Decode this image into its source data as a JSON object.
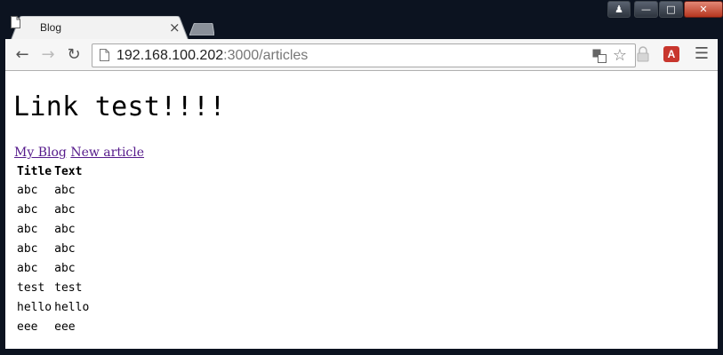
{
  "browser": {
    "tab": {
      "title": "Blog"
    },
    "address": {
      "host": "192.168.100.202",
      "rest": ":3000/articles"
    },
    "extensions": {
      "a_label": "A"
    }
  },
  "page": {
    "heading": "Link test!!!!",
    "links": [
      {
        "label": "My Blog"
      },
      {
        "label": "New article"
      }
    ],
    "table": {
      "headers": [
        "Title",
        "Text"
      ],
      "rows": [
        [
          "abc",
          "abc"
        ],
        [
          "abc",
          "abc"
        ],
        [
          "abc",
          "abc"
        ],
        [
          "abc",
          "abc"
        ],
        [
          "abc",
          "abc"
        ],
        [
          "test",
          "test"
        ],
        [
          "hello",
          "hello"
        ],
        [
          "eee",
          "eee"
        ]
      ]
    }
  },
  "colors": {
    "frame": "#0c1320",
    "visited_link": "#551a8b",
    "close_button": "#c8402a",
    "extension_badge": "#c8362d"
  },
  "icons": [
    "page-icon",
    "close-icon",
    "back-arrow-icon",
    "forward-arrow-icon",
    "reload-icon",
    "translate-icon",
    "star-icon",
    "lock-extension-icon",
    "acrobat-icon",
    "menu-icon",
    "user-icon",
    "minimize-icon",
    "maximize-icon",
    "window-close-icon"
  ]
}
